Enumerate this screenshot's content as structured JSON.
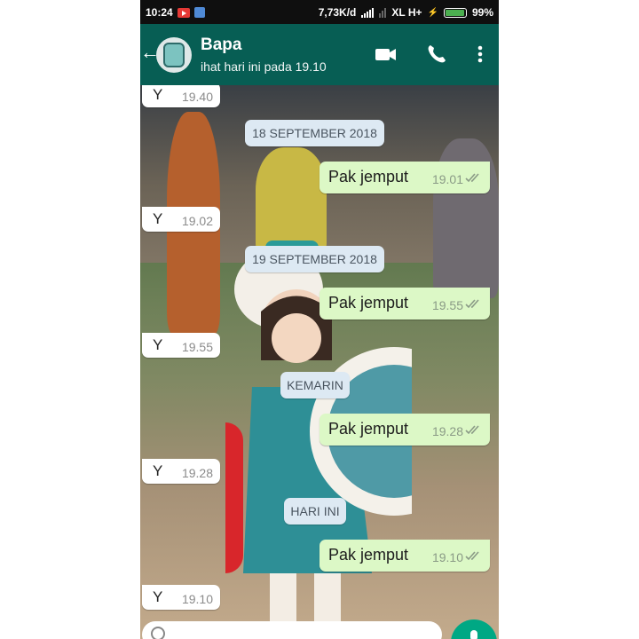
{
  "status_bar": {
    "time": "10:24",
    "speed": "7,73K/d",
    "network": "XL H+",
    "battery": "99%"
  },
  "header": {
    "contact_name": "Bapa",
    "last_seen": "ihat hari ini pada 19.10"
  },
  "messages": [
    {
      "type": "in",
      "text": "Y",
      "time": "19.40"
    },
    {
      "type": "date",
      "text": "18 SEPTEMBER 2018"
    },
    {
      "type": "out",
      "text": "Pak jemput",
      "time": "19.01"
    },
    {
      "type": "in",
      "text": "Y",
      "time": "19.02"
    },
    {
      "type": "date",
      "text": "19 SEPTEMBER 2018"
    },
    {
      "type": "out",
      "text": "Pak jemput",
      "time": "19.55"
    },
    {
      "type": "in",
      "text": "Y",
      "time": "19.55"
    },
    {
      "type": "date",
      "text": "KEMARIN"
    },
    {
      "type": "out",
      "text": "Pak jemput",
      "time": "19.28"
    },
    {
      "type": "in",
      "text": "Y",
      "time": "19.28"
    },
    {
      "type": "date",
      "text": "HARI INI"
    },
    {
      "type": "out",
      "text": "Pak jemput",
      "time": "19.10"
    },
    {
      "type": "in",
      "text": "Y",
      "time": "19.10"
    }
  ],
  "colors": {
    "header": "#075e54",
    "outgoing_bubble": "#dcf8c6",
    "incoming_bubble": "#ffffff",
    "date_pill": "#dde9f3",
    "send_button": "#00a884"
  }
}
